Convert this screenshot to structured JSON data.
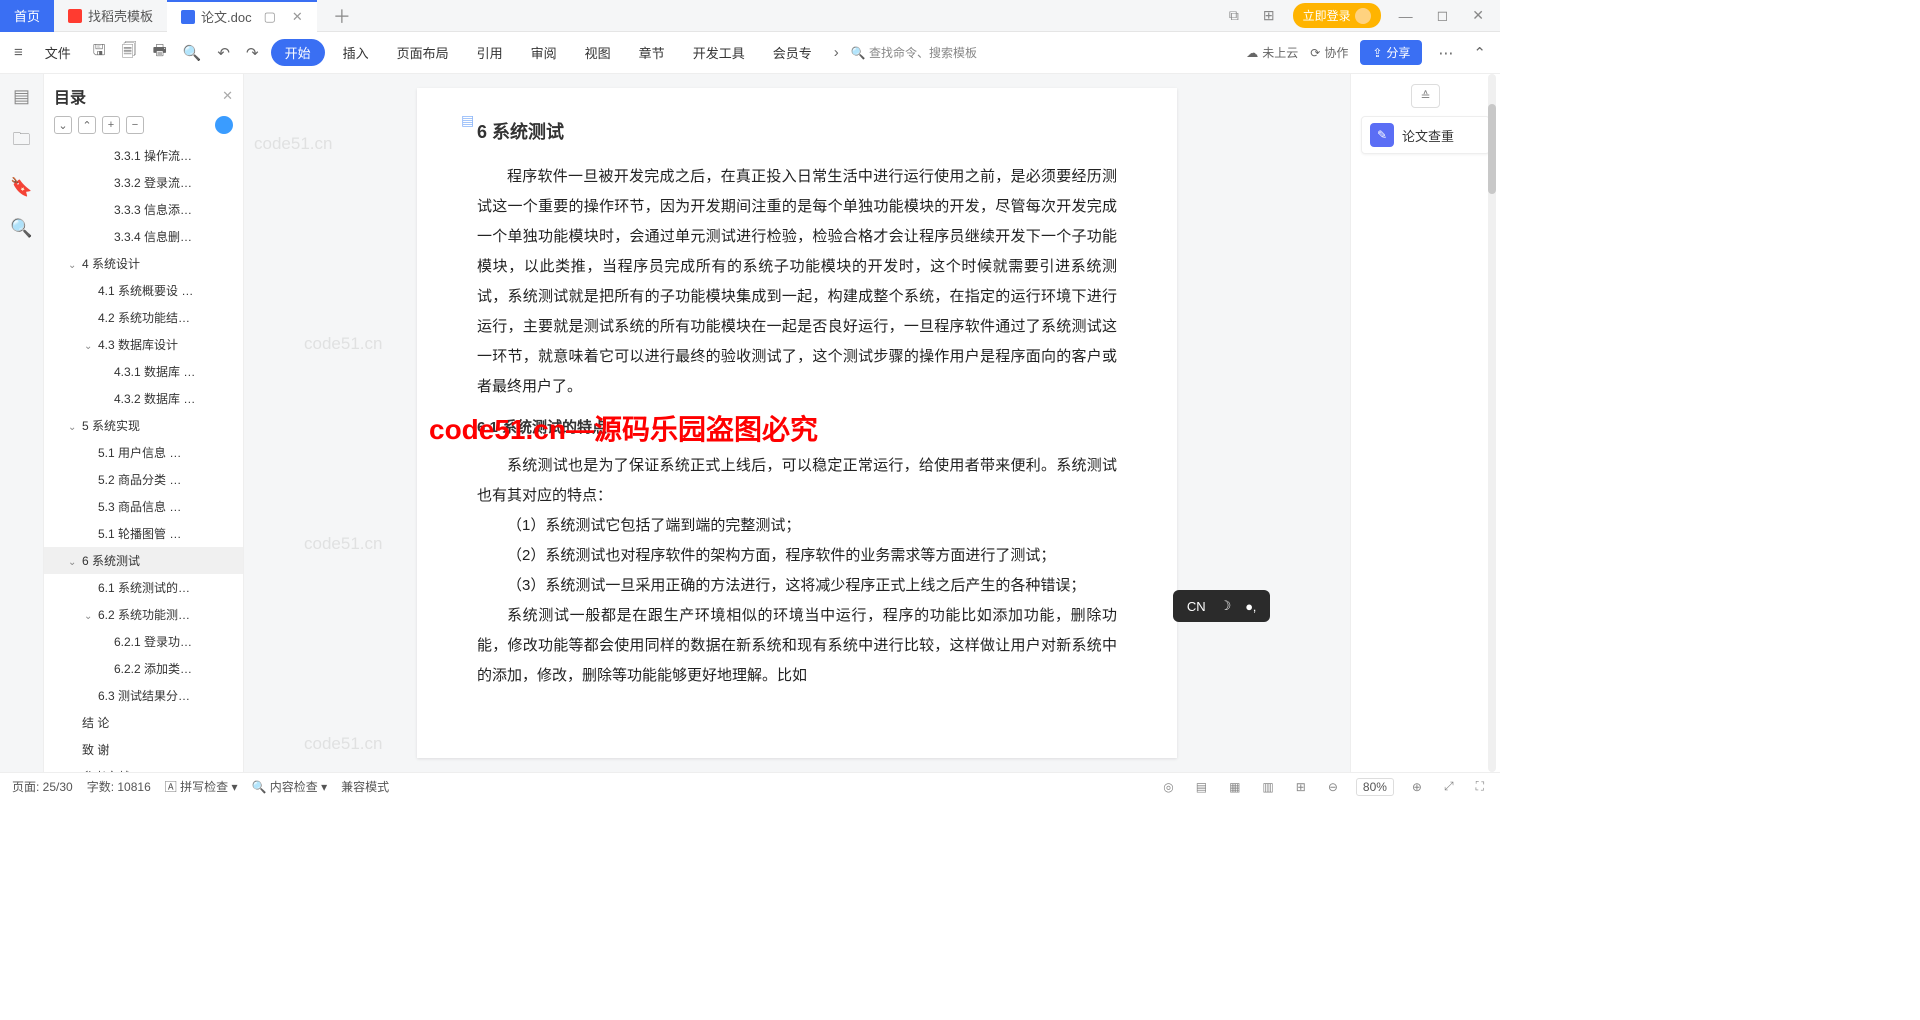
{
  "tabs": {
    "home": "首页",
    "template": "找稻壳模板",
    "doc": "论文.doc",
    "plus": "＋"
  },
  "topright": {
    "login": "立即登录"
  },
  "menu": {
    "file": "文件",
    "start": "开始",
    "insert": "插入",
    "layout": "页面布局",
    "ref": "引用",
    "review": "审阅",
    "view": "视图",
    "chapter": "章节",
    "devtools": "开发工具",
    "member": "会员专",
    "search": "查找命令、搜索模板",
    "cloud": "未上云",
    "coop": "协作",
    "share": "分享"
  },
  "outline": {
    "title": "目录",
    "items": [
      {
        "lvl": 3,
        "t": "3.3.1 操作流…"
      },
      {
        "lvl": 3,
        "t": "3.3.2 登录流…"
      },
      {
        "lvl": 3,
        "t": "3.3.3 信息添…"
      },
      {
        "lvl": 3,
        "t": "3.3.4 信息删…"
      },
      {
        "lvl": 1,
        "t": "4  系统设计",
        "caret": "v"
      },
      {
        "lvl": 2,
        "t": "4.1  系统概要设 …"
      },
      {
        "lvl": 2,
        "t": "4.2  系统功能结…"
      },
      {
        "lvl": 2,
        "t": "4.3  数据库设计",
        "caret": "v"
      },
      {
        "lvl": 3,
        "t": "4.3.1 数据库 …"
      },
      {
        "lvl": 3,
        "t": "4.3.2 数据库 …"
      },
      {
        "lvl": 1,
        "t": "5  系统实现",
        "caret": "v"
      },
      {
        "lvl": 2,
        "t": "5.1 用户信息 …"
      },
      {
        "lvl": 2,
        "t": "5.2  商品分类 …"
      },
      {
        "lvl": 2,
        "t": "5.3  商品信息 …"
      },
      {
        "lvl": 2,
        "t": "5.1  轮播图管 …"
      },
      {
        "lvl": 1,
        "t": "6  系统测试",
        "caret": "v",
        "sel": true
      },
      {
        "lvl": 2,
        "t": "6.1  系统测试的…"
      },
      {
        "lvl": 2,
        "t": "6.2  系统功能测…",
        "caret": "v"
      },
      {
        "lvl": 3,
        "t": "6.2.1 登录功…"
      },
      {
        "lvl": 3,
        "t": "6.2.2 添加类…"
      },
      {
        "lvl": 2,
        "t": "6.3  测试结果分…"
      },
      {
        "lvl": 1,
        "t": "结    论"
      },
      {
        "lvl": 1,
        "t": "致    谢"
      },
      {
        "lvl": 1,
        "t": "参考文献"
      }
    ]
  },
  "doc": {
    "h1": "6  系统测试",
    "p1": "程序软件一旦被开发完成之后，在真正投入日常生活中进行运行使用之前，是必须要经历测试这一个重要的操作环节，因为开发期间注重的是每个单独功能模块的开发，尽管每次开发完成一个单独功能模块时，会通过单元测试进行检验，检验合格才会让程序员继续开发下一个子功能模块，以此类推，当程序员完成所有的系统子功能模块的开发时，这个时候就需要引进系统测试，系统测试就是把所有的子功能模块集成到一起，构建成整个系统，在指定的运行环境下进行运行，主要就是测试系统的所有功能模块在一起是否良好运行，一旦程序软件通过了系统测试这一环节，就意味着它可以进行最终的验收测试了，这个测试步骤的操作用户是程序面向的客户或者最终用户了。",
    "h2": "6.1  系统测试的特点",
    "p2": "系统测试也是为了保证系统正式上线后，可以稳定正常运行，给使用者带来便利。系统测试也有其对应的特点：",
    "li1": "（1）系统测试它包括了端到端的完整测试；",
    "li2": "（2）系统测试也对程序软件的架构方面，程序软件的业务需求等方面进行了测试；",
    "li3": "（3）系统测试一旦采用正确的方法进行，这将减少程序正式上线之后产生的各种错误；",
    "p3": "系统测试一般都是在跟生产环境相似的环境当中运行，程序的功能比如添加功能，删除功能，修改功能等都会使用同样的数据在新系统和现有系统中进行比较，这样做让用户对新系统中的添加，修改，删除等功能能够更好地理解。比如"
  },
  "watermark": "code51.cn",
  "bigwm": "code51.cn—源码乐园盗图必究",
  "rightpanel": {
    "card": "论文查重"
  },
  "ime": {
    "mode": "CN",
    "moon": "☽",
    "dots": "●‚"
  },
  "status": {
    "page": "页面: 25/30",
    "words": "字数: 10816",
    "spell": "拼写检查",
    "content": "内容检查",
    "compat": "兼容模式",
    "zoom": "80%"
  }
}
